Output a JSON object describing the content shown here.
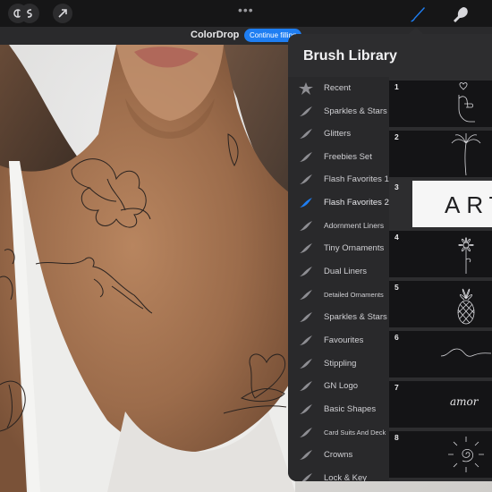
{
  "toolbar": {
    "tools": [
      {
        "name": "adjustments-icon"
      },
      {
        "name": "selection-icon"
      },
      {
        "name": "transform-icon"
      }
    ],
    "more": "•••",
    "right_tools": [
      {
        "name": "brush-icon",
        "active": true
      },
      {
        "name": "smudge-icon",
        "active": false
      }
    ]
  },
  "colordrop": {
    "title": "ColorDrop",
    "action": "Continue filling"
  },
  "brush_library": {
    "title": "Brush Library",
    "sets": [
      {
        "label": "Recent",
        "icon": "star-icon"
      },
      {
        "label": "Sparkles & Stars",
        "icon": "brush-set-icon"
      },
      {
        "label": "Glitters",
        "icon": "brush-set-icon"
      },
      {
        "label": "Freebies Set",
        "icon": "brush-set-icon"
      },
      {
        "label": "Flash Favorites 1",
        "icon": "brush-set-icon"
      },
      {
        "label": "Flash Favorites 2",
        "icon": "brush-set-icon",
        "active": true
      },
      {
        "label": "Adornment Liners",
        "icon": "brush-set-icon"
      },
      {
        "label": "Tiny Ornaments",
        "icon": "brush-set-icon"
      },
      {
        "label": "Dual Liners",
        "icon": "brush-set-icon"
      },
      {
        "label": "Detailed Ornaments",
        "icon": "brush-set-icon",
        "small": true
      },
      {
        "label": "Sparkles & Stars",
        "icon": "brush-set-icon"
      },
      {
        "label": "Favourites",
        "icon": "brush-set-icon"
      },
      {
        "label": "Stippling",
        "icon": "brush-set-icon"
      },
      {
        "label": "GN Logo",
        "icon": "brush-set-icon"
      },
      {
        "label": "Basic Shapes",
        "icon": "brush-set-icon"
      },
      {
        "label": "Card Suits And Deck",
        "icon": "brush-set-icon",
        "small": true
      },
      {
        "label": "Crowns",
        "icon": "brush-set-icon"
      },
      {
        "label": "Lock & Key",
        "icon": "brush-set-icon"
      }
    ],
    "brushes": [
      {
        "number": "1",
        "preview": "hand-heart"
      },
      {
        "number": "2",
        "preview": "palm-tree"
      },
      {
        "number": "3",
        "preview": "art-text",
        "text": "ART"
      },
      {
        "number": "4",
        "preview": "flower"
      },
      {
        "number": "5",
        "preview": "pineapple"
      },
      {
        "number": "6",
        "preview": "wave"
      },
      {
        "number": "7",
        "preview": "amor-script",
        "text": "amor"
      },
      {
        "number": "8",
        "preview": "sun-spiral"
      }
    ]
  },
  "colors": {
    "accent": "#1f7ef2",
    "panel": "#2d2d2f",
    "toolbar": "#161617"
  }
}
